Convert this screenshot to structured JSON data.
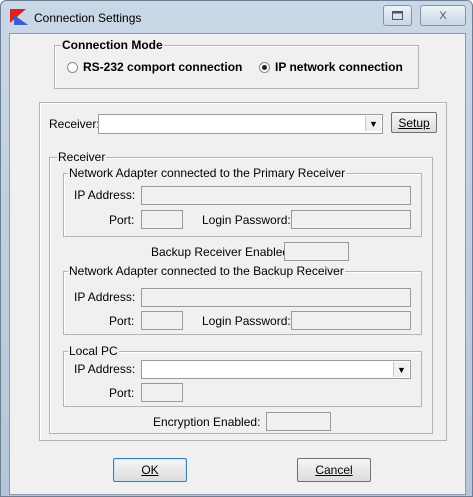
{
  "window": {
    "title": "Connection Settings",
    "controls": {
      "restore_icon": "restore-icon",
      "close_icon": "close-icon",
      "close_glyph": "X"
    }
  },
  "connection_mode": {
    "title": "Connection Mode",
    "options": [
      {
        "label": "RS-232 comport connection",
        "selected": false
      },
      {
        "label": "IP network connection",
        "selected": true
      }
    ]
  },
  "receiver_select": {
    "label": "Receiver:",
    "value": "",
    "setup_button": "Setup"
  },
  "receiver_group": {
    "title": "Receiver",
    "primary": {
      "title": "Network Adapter connected to the Primary Receiver",
      "ip_label": "IP Address:",
      "ip_value": "",
      "port_label": "Port:",
      "port_value": "",
      "password_label": "Login Password:",
      "password_value": ""
    },
    "backup_enabled_label": "Backup Receiver Enabled:",
    "backup_enabled_value": "",
    "backup": {
      "title": "Network Adapter connected to the Backup Receiver",
      "ip_label": "IP Address:",
      "ip_value": "",
      "port_label": "Port:",
      "port_value": "",
      "password_label": "Login Password:",
      "password_value": ""
    },
    "local_pc": {
      "title": "Local PC",
      "ip_label": "IP Address:",
      "ip_value": "",
      "port_label": "Port:",
      "port_value": ""
    },
    "encryption_label": "Encryption Enabled:",
    "encryption_value": ""
  },
  "footer": {
    "ok_label": "OK",
    "cancel_label": "Cancel"
  }
}
